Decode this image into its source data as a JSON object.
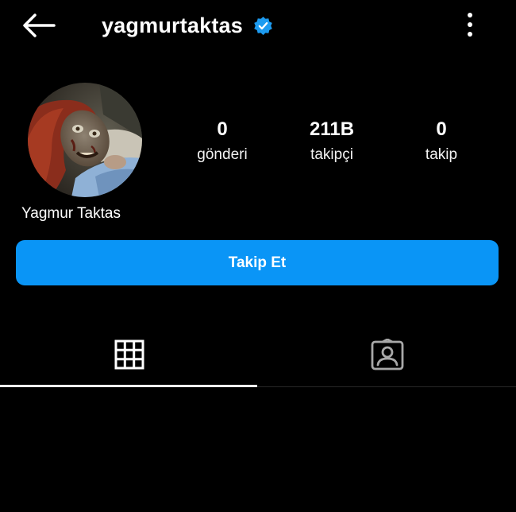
{
  "header": {
    "username": "yagmurtaktas",
    "back_icon": "arrow-left-icon",
    "verified_icon": "verified-badge-icon",
    "more_icon": "more-vertical-icon"
  },
  "profile": {
    "display_name": "Yagmur Taktas",
    "avatar_icon": "profile-avatar"
  },
  "stats": [
    {
      "value": "0",
      "label": "gönderi"
    },
    {
      "value": "211B",
      "label": "takipçi"
    },
    {
      "value": "0",
      "label": "takip"
    }
  ],
  "actions": {
    "follow_label": "Takip Et"
  },
  "tabs": [
    {
      "icon": "grid-icon",
      "active": true
    },
    {
      "icon": "tagged-icon",
      "active": false
    }
  ],
  "colors": {
    "background": "#000000",
    "primary_button": "#0a95f6",
    "verified_badge": "#1d9bf0",
    "text": "#ffffff",
    "inactive_icon": "#a8a8a8"
  }
}
